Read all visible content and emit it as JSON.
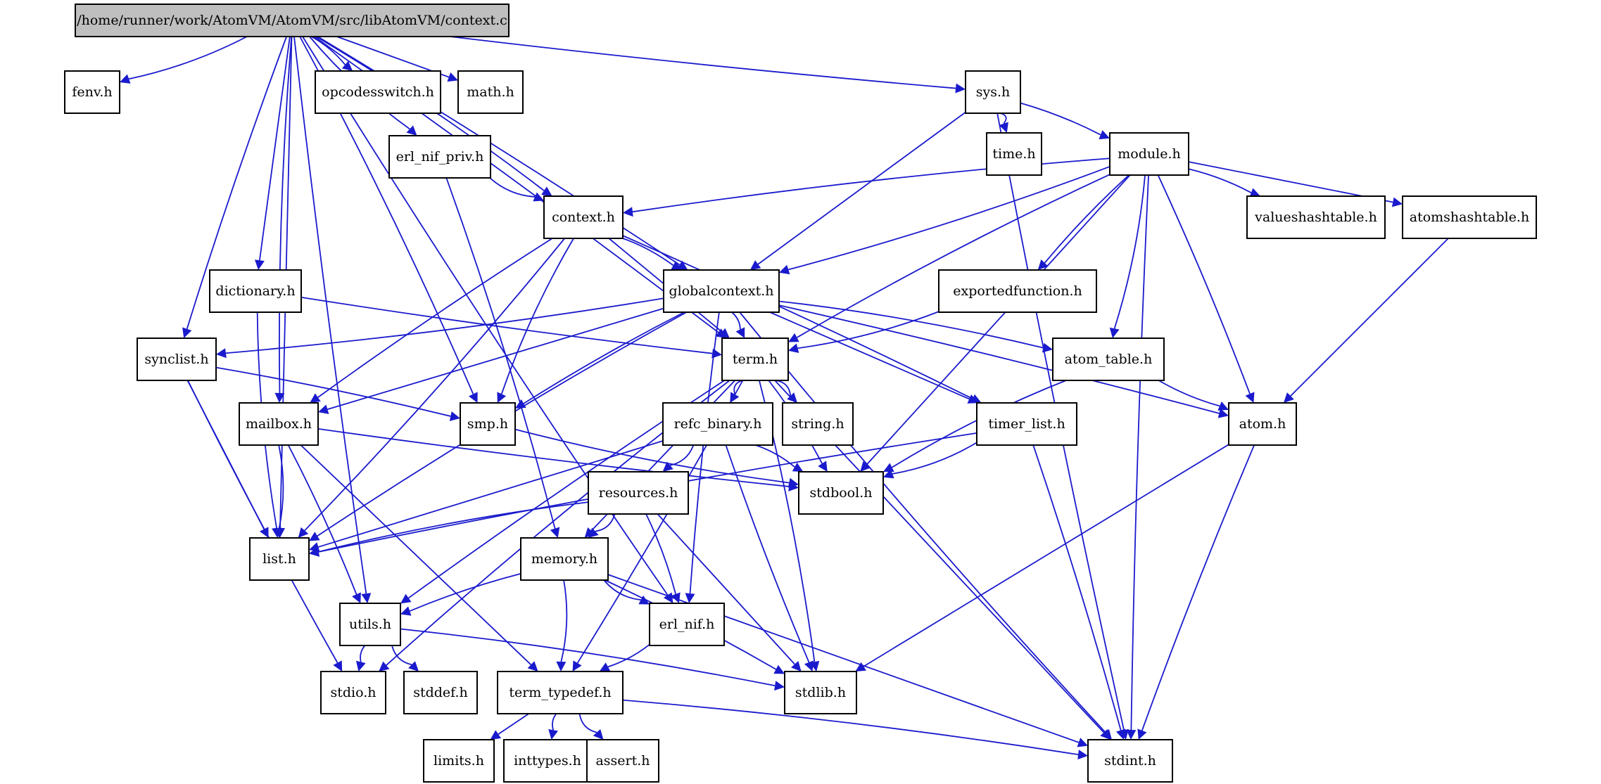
{
  "title": "/home/runner/work/AtomVM/AtomVM/src/libAtomVM/context.c",
  "colors": {
    "edge": "#1a1acd",
    "root_fill": "#bfbfbf",
    "node_fill": "#ffffff",
    "border": "#000000"
  },
  "nodes": [
    {
      "id": "context_c",
      "label": "/home/runner/work/AtomVM/AtomVM/src/libAtomVM/context.c",
      "root": true
    },
    {
      "id": "fenv_h",
      "label": "fenv.h"
    },
    {
      "id": "opcodesswitch_h",
      "label": "opcodesswitch.h"
    },
    {
      "id": "math_h",
      "label": "math.h"
    },
    {
      "id": "sys_h",
      "label": "sys.h"
    },
    {
      "id": "time_h",
      "label": "time.h"
    },
    {
      "id": "module_h",
      "label": "module.h"
    },
    {
      "id": "erl_nif_priv_h",
      "label": "erl_nif_priv.h"
    },
    {
      "id": "context_h",
      "label": "context.h"
    },
    {
      "id": "valueshashtable_h",
      "label": "valueshashtable.h"
    },
    {
      "id": "atomshashtable_h",
      "label": "atomshashtable.h"
    },
    {
      "id": "dictionary_h",
      "label": "dictionary.h"
    },
    {
      "id": "globalcontext_h",
      "label": "globalcontext.h"
    },
    {
      "id": "exportedfunction_h",
      "label": "exportedfunction.h"
    },
    {
      "id": "synclist_h",
      "label": "synclist.h"
    },
    {
      "id": "term_h",
      "label": "term.h"
    },
    {
      "id": "atom_table_h",
      "label": "atom_table.h"
    },
    {
      "id": "mailbox_h",
      "label": "mailbox.h"
    },
    {
      "id": "smp_h",
      "label": "smp.h"
    },
    {
      "id": "refc_binary_h",
      "label": "refc_binary.h"
    },
    {
      "id": "string_h",
      "label": "string.h"
    },
    {
      "id": "timer_list_h",
      "label": "timer_list.h"
    },
    {
      "id": "atom_h",
      "label": "atom.h"
    },
    {
      "id": "resources_h",
      "label": "resources.h"
    },
    {
      "id": "stdbool_h",
      "label": "stdbool.h"
    },
    {
      "id": "list_h",
      "label": "list.h"
    },
    {
      "id": "memory_h",
      "label": "memory.h"
    },
    {
      "id": "utils_h",
      "label": "utils.h"
    },
    {
      "id": "erl_nif_h",
      "label": "erl_nif.h"
    },
    {
      "id": "stdio_h",
      "label": "stdio.h"
    },
    {
      "id": "stddef_h",
      "label": "stddef.h"
    },
    {
      "id": "term_typedef_h",
      "label": "term_typedef.h"
    },
    {
      "id": "stdlib_h",
      "label": "stdlib.h"
    },
    {
      "id": "limits_h",
      "label": "limits.h"
    },
    {
      "id": "inttypes_h",
      "label": "inttypes.h"
    },
    {
      "id": "assert_h",
      "label": "assert.h"
    },
    {
      "id": "stdint_h",
      "label": "stdint.h"
    }
  ],
  "edges": [
    [
      "context_c",
      "fenv_h"
    ],
    [
      "context_c",
      "opcodesswitch_h"
    ],
    [
      "context_c",
      "math_h"
    ],
    [
      "context_c",
      "sys_h"
    ],
    [
      "context_c",
      "erl_nif_priv_h"
    ],
    [
      "context_c",
      "context_h"
    ],
    [
      "context_c",
      "globalcontext_h"
    ],
    [
      "context_c",
      "dictionary_h"
    ],
    [
      "context_c",
      "synclist_h"
    ],
    [
      "context_c",
      "mailbox_h"
    ],
    [
      "context_c",
      "smp_h"
    ],
    [
      "context_c",
      "term_h"
    ],
    [
      "context_c",
      "list_h"
    ],
    [
      "context_c",
      "utils_h"
    ],
    [
      "context_c",
      "erl_nif_h"
    ],
    [
      "sys_h",
      "time_h"
    ],
    [
      "sys_h",
      "module_h"
    ],
    [
      "sys_h",
      "globalcontext_h"
    ],
    [
      "sys_h",
      "stdint_h"
    ],
    [
      "module_h",
      "context_h"
    ],
    [
      "module_h",
      "globalcontext_h"
    ],
    [
      "module_h",
      "valueshashtable_h"
    ],
    [
      "module_h",
      "atomshashtable_h"
    ],
    [
      "module_h",
      "exportedfunction_h"
    ],
    [
      "module_h",
      "term_h"
    ],
    [
      "module_h",
      "atom_table_h"
    ],
    [
      "module_h",
      "atom_h"
    ],
    [
      "module_h",
      "stdbool_h"
    ],
    [
      "module_h",
      "stdint_h"
    ],
    [
      "erl_nif_priv_h",
      "context_h"
    ],
    [
      "erl_nif_priv_h",
      "memory_h"
    ],
    [
      "context_h",
      "globalcontext_h"
    ],
    [
      "context_h",
      "term_h"
    ],
    [
      "context_h",
      "mailbox_h"
    ],
    [
      "context_h",
      "smp_h"
    ],
    [
      "context_h",
      "list_h"
    ],
    [
      "context_h",
      "timer_list_h"
    ],
    [
      "atomshashtable_h",
      "atom_h"
    ],
    [
      "dictionary_h",
      "term_h"
    ],
    [
      "dictionary_h",
      "list_h"
    ],
    [
      "globalcontext_h",
      "synclist_h"
    ],
    [
      "globalcontext_h",
      "term_h"
    ],
    [
      "globalcontext_h",
      "mailbox_h"
    ],
    [
      "globalcontext_h",
      "smp_h"
    ],
    [
      "globalcontext_h",
      "list_h"
    ],
    [
      "globalcontext_h",
      "atom_table_h"
    ],
    [
      "globalcontext_h",
      "atom_h"
    ],
    [
      "globalcontext_h",
      "timer_list_h"
    ],
    [
      "globalcontext_h",
      "erl_nif_h"
    ],
    [
      "globalcontext_h",
      "stdint_h"
    ],
    [
      "exportedfunction_h",
      "term_h"
    ],
    [
      "synclist_h",
      "smp_h"
    ],
    [
      "synclist_h",
      "list_h"
    ],
    [
      "synclist_h",
      "stdio_h"
    ],
    [
      "term_h",
      "refc_binary_h"
    ],
    [
      "term_h",
      "string_h"
    ],
    [
      "term_h",
      "stdbool_h"
    ],
    [
      "term_h",
      "memory_h"
    ],
    [
      "term_h",
      "utils_h"
    ],
    [
      "term_h",
      "stdio_h"
    ],
    [
      "term_h",
      "stdlib_h"
    ],
    [
      "term_h",
      "term_typedef_h"
    ],
    [
      "term_h",
      "stdint_h"
    ],
    [
      "atom_table_h",
      "atom_h"
    ],
    [
      "atom_table_h",
      "stdbool_h"
    ],
    [
      "mailbox_h",
      "list_h"
    ],
    [
      "mailbox_h",
      "utils_h"
    ],
    [
      "mailbox_h",
      "term_typedef_h"
    ],
    [
      "mailbox_h",
      "stdbool_h"
    ],
    [
      "smp_h",
      "stdbool_h"
    ],
    [
      "refc_binary_h",
      "resources_h"
    ],
    [
      "refc_binary_h",
      "stdbool_h"
    ],
    [
      "refc_binary_h",
      "list_h"
    ],
    [
      "refc_binary_h",
      "stdlib_h"
    ],
    [
      "timer_list_h",
      "list_h"
    ],
    [
      "timer_list_h",
      "stdbool_h"
    ],
    [
      "timer_list_h",
      "stdint_h"
    ],
    [
      "atom_h",
      "stdlib_h"
    ],
    [
      "atom_h",
      "stdint_h"
    ],
    [
      "resources_h",
      "list_h"
    ],
    [
      "resources_h",
      "memory_h"
    ],
    [
      "resources_h",
      "erl_nif_h"
    ],
    [
      "resources_h",
      "stdlib_h"
    ],
    [
      "memory_h",
      "utils_h"
    ],
    [
      "memory_h",
      "erl_nif_h"
    ],
    [
      "memory_h",
      "term_typedef_h"
    ],
    [
      "memory_h",
      "stdlib_h"
    ],
    [
      "memory_h",
      "stdint_h"
    ],
    [
      "utils_h",
      "stdio_h"
    ],
    [
      "utils_h",
      "stddef_h"
    ],
    [
      "utils_h",
      "stdlib_h"
    ],
    [
      "erl_nif_h",
      "term_typedef_h"
    ],
    [
      "term_typedef_h",
      "limits_h"
    ],
    [
      "term_typedef_h",
      "inttypes_h"
    ],
    [
      "term_typedef_h",
      "assert_h"
    ],
    [
      "term_typedef_h",
      "stdint_h"
    ]
  ]
}
